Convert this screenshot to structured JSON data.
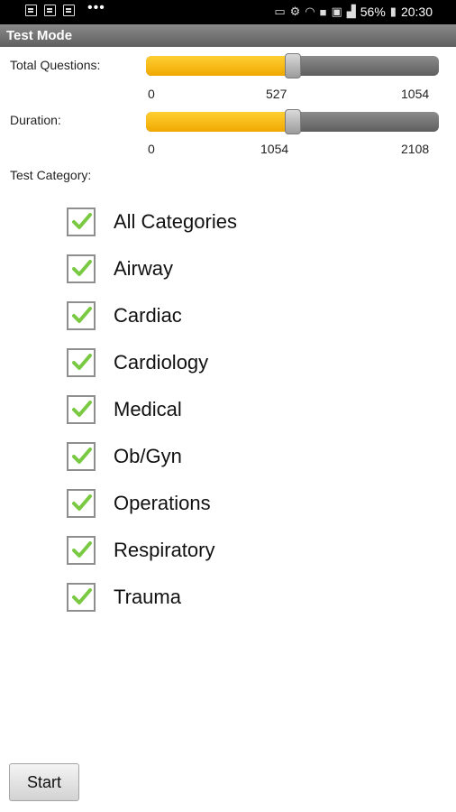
{
  "status_bar": {
    "battery": "56%",
    "time": "20:30"
  },
  "title": "Test Mode",
  "sliders": {
    "questions": {
      "label": "Total Questions:",
      "min": "0",
      "mid": "527",
      "max": "1054",
      "value_fraction": 0.5
    },
    "duration": {
      "label": "Duration:",
      "min": "0",
      "mid": "1054",
      "max": "2108",
      "value_fraction": 0.5
    }
  },
  "category_label": "Test Category:",
  "categories": [
    {
      "label": "All Categories",
      "checked": true
    },
    {
      "label": "Airway",
      "checked": true
    },
    {
      "label": "Cardiac",
      "checked": true
    },
    {
      "label": "Cardiology",
      "checked": true
    },
    {
      "label": "Medical",
      "checked": true
    },
    {
      "label": "Ob/Gyn",
      "checked": true
    },
    {
      "label": "Operations",
      "checked": true
    },
    {
      "label": "Respiratory",
      "checked": true
    },
    {
      "label": "Trauma",
      "checked": true
    }
  ],
  "start_label": "Start",
  "colors": {
    "accent": "#f5b400",
    "check": "#7ac943"
  }
}
